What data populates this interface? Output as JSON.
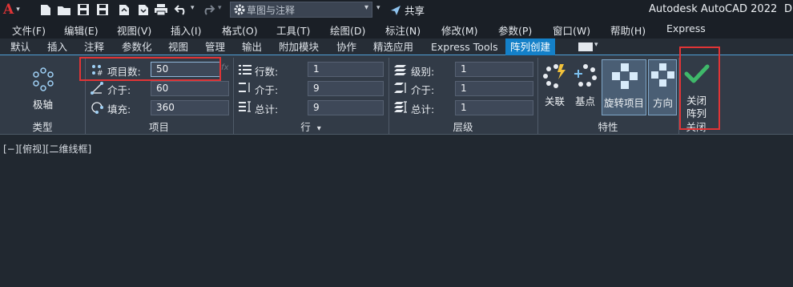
{
  "titlebar": {
    "app_menu_letter": "A",
    "workspace": "草图与注释",
    "share": "共享",
    "app_title": "Autodesk AutoCAD 2022",
    "trailing": "D"
  },
  "menu": [
    "文件(F)",
    "编辑(E)",
    "视图(V)",
    "插入(I)",
    "格式(O)",
    "工具(T)",
    "绘图(D)",
    "标注(N)",
    "修改(M)",
    "参数(P)",
    "窗口(W)",
    "帮助(H)",
    "Express"
  ],
  "tabs": [
    "默认",
    "插入",
    "注释",
    "参数化",
    "视图",
    "管理",
    "输出",
    "附加模块",
    "协作",
    "精选应用",
    "Express Tools",
    "阵列创建"
  ],
  "active_tab": "阵列创建",
  "ribbon": {
    "type_panel": {
      "button": "极轴",
      "footer": "类型"
    },
    "items_panel": {
      "count_label": "项目数:",
      "count_value": "50",
      "between_label": "介于:",
      "between_value": "60",
      "fill_label": "填充:",
      "fill_value": "360",
      "footer": "项目"
    },
    "rows_panel": {
      "rows_label": "行数:",
      "rows_value": "1",
      "between_label": "介于:",
      "between_value": "9",
      "total_label": "总计:",
      "total_value": "9",
      "footer": "行"
    },
    "levels_panel": {
      "levels_label": "级别:",
      "levels_value": "1",
      "between_label": "介于:",
      "between_value": "1",
      "total_label": "总计:",
      "total_value": "1",
      "footer": "层级"
    },
    "props_panel": {
      "associative": "关联",
      "base_point": "基点",
      "rotate_items": "旋转项目",
      "direction": "方向",
      "footer": "特性"
    },
    "close_panel": {
      "line1": "关闭",
      "line2": "阵列",
      "footer": "关闭"
    }
  },
  "viewport": {
    "label": "[−][俯视][二维线框]"
  },
  "colors": {
    "accent": "#1480c8",
    "highlight_box": "#e03436",
    "check": "#3fb86a"
  }
}
